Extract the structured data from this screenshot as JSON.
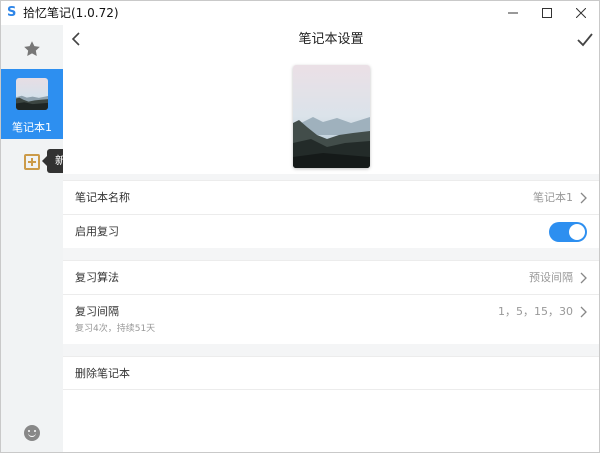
{
  "app": {
    "logo_letter": "S",
    "title": "拾忆笔记(1.0.72)"
  },
  "sidebar": {
    "notebook_label": "笔记本1",
    "add_tooltip": "新建笔记本"
  },
  "header": {
    "title": "笔记本设置"
  },
  "settings": {
    "name": {
      "label": "笔记本名称",
      "value": "笔记本1"
    },
    "review_enabled": {
      "label": "启用复习",
      "enabled": true
    },
    "algorithm": {
      "label": "复习算法",
      "value": "预设间隔"
    },
    "interval": {
      "label": "复习间隔",
      "value": "1，5，15，30",
      "sub": "复习4次，持续51天"
    },
    "delete": {
      "label": "删除笔记本"
    }
  },
  "colors": {
    "accent": "#2d8ff0",
    "add_icon": "#cc9b49",
    "tooltip_bg": "#323232"
  },
  "icons": [
    "star-icon",
    "add-notebook-icon",
    "smile-icon",
    "back-icon",
    "check-icon",
    "chevron-right-icon",
    "minimize-icon",
    "maximize-icon",
    "close-icon"
  ]
}
